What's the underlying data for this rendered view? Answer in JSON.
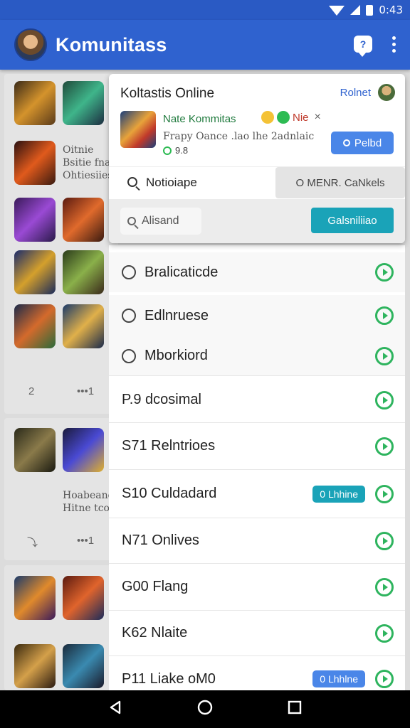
{
  "status_bar": {
    "time": "0:43"
  },
  "app_bar": {
    "title": "Komunitass",
    "chat_icon": "chat-icon",
    "more_icon": "more-vert-icon"
  },
  "background_panels": {
    "text_a": [
      "Oitnie",
      "Bsitie fna",
      "Ohtiesiies"
    ],
    "count_a": "2",
    "text_b": [
      "Hoabeano",
      "Hitne tcom"
    ],
    "dots": "•••1"
  },
  "card": {
    "title": "Koltastis Online",
    "right_label": "Rolnet",
    "game_name": "Nate Kommitas",
    "badge_label": "Nie",
    "close_symbol": "×",
    "description": "Frapy Oance .lao lhe 2adnlaic",
    "rating": "9.8",
    "primary_button": "Pelbd",
    "notice_label": "Notioiape",
    "mode_label": "O MENR. CaNkels",
    "alt_input_placeholder": "Alisand",
    "teal_button": "Galsniliiao"
  },
  "list": {
    "items": [
      {
        "label": "Bralicaticde",
        "icon": "robot-icon",
        "tag": ""
      },
      {
        "label": "Edlnruese",
        "icon": "person-icon",
        "tag": ""
      },
      {
        "label": "Mborkiord",
        "icon": "smile-icon",
        "tag": ""
      },
      {
        "label": "P.9 dcosimal",
        "icon": "",
        "tag": ""
      },
      {
        "label": "S71 Relntrioes",
        "icon": "",
        "tag": ""
      },
      {
        "label": "S10 Culdadard",
        "icon": "",
        "tag": "0 Lhhine"
      },
      {
        "label": "N71 Onlives",
        "icon": "",
        "tag": ""
      },
      {
        "label": "G00 Flang",
        "icon": "",
        "tag": ""
      },
      {
        "label": "K62 Nlaite",
        "icon": "",
        "tag": ""
      },
      {
        "label": "P11 Liake oM0",
        "icon": "",
        "tag": "0 Lhhlne"
      }
    ]
  },
  "colors": {
    "app_bar": "#2f62cf",
    "teal": "#1aa3b8",
    "blue_tag": "#4a86e8",
    "green_check": "#2eb45e"
  }
}
